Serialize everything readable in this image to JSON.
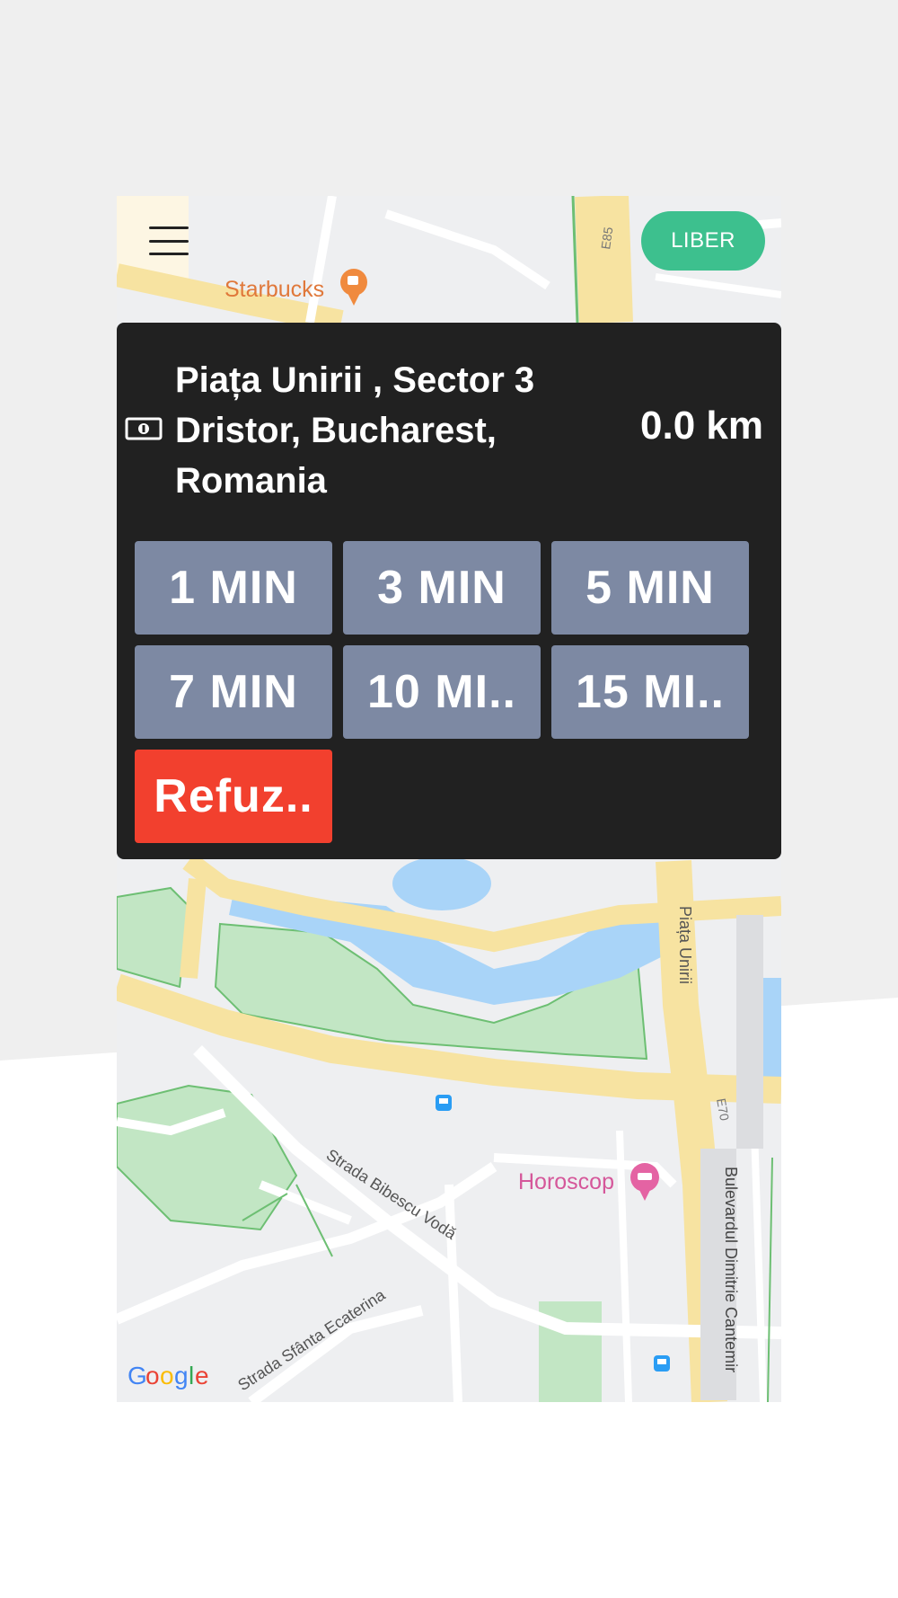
{
  "header": {
    "status_button": "LIBER"
  },
  "request": {
    "address_line1": "Piața Unirii  , Sector 3",
    "address_line2": "Dristor, Bucharest,",
    "address_line3": "Romania",
    "distance": "0.0 km",
    "payment_icon": "cash-icon"
  },
  "time_options": [
    "1 MIN",
    "3 MIN",
    "5 MIN",
    "7 MIN",
    "10 MI..",
    "15 MI.."
  ],
  "refuse_label": "Refuz..",
  "map": {
    "labels": {
      "starbucks": "Starbucks",
      "horoscop": "Horoscop",
      "piata_unirii": "Piața Unirii",
      "bibescu": "Strada Bibescu Vodă",
      "sfanta": "Strada Sfânta Ecaterina",
      "cantemir": "Bulevardul Dimitrie Cantemir",
      "e85": "E85",
      "e70": "E70",
      "google_g1": "G",
      "google_o1": "o",
      "google_o2": "o",
      "google_g2": "g",
      "google_l": "l",
      "google_e": "e"
    }
  },
  "colors": {
    "accent_green": "#3dc08e",
    "panel": "#212121",
    "time_button": "#7d89a3",
    "refuse": "#f2402e"
  }
}
